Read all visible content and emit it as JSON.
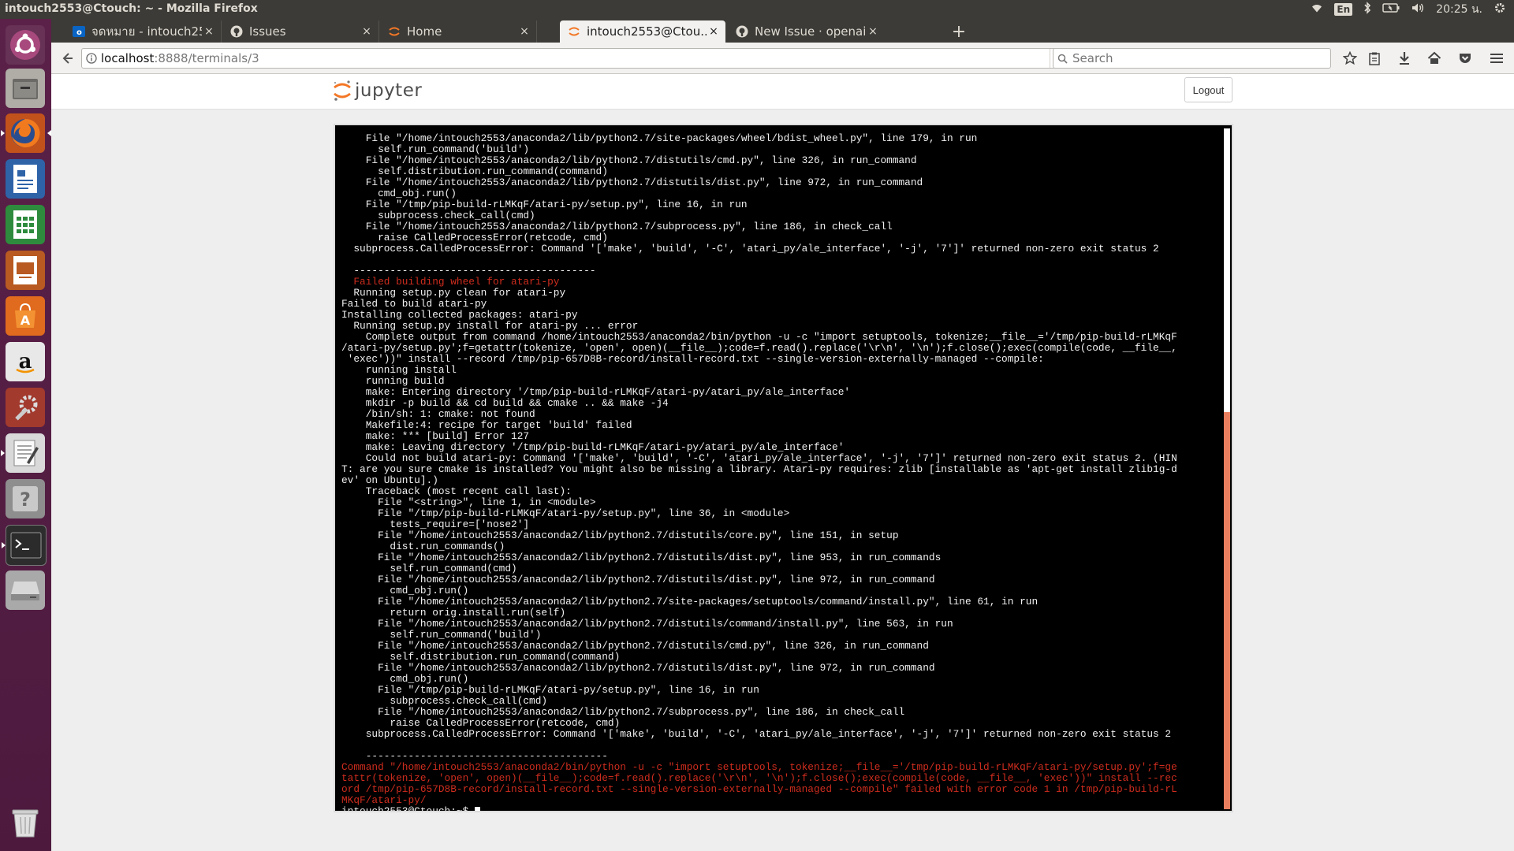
{
  "window": {
    "title": "intouch2553@Ctouch: ~ - Mozilla Firefox",
    "lang": "En",
    "clock": "20:25 น."
  },
  "tabs": [
    {
      "label": "จดหมาย - intouch25...",
      "icon": "outlook-icon",
      "active": false
    },
    {
      "label": "Issues",
      "icon": "github-icon",
      "active": false
    },
    {
      "label": "Home",
      "icon": "jupyter-icon",
      "active": false
    },
    {
      "label": "intouch2553@Ctou...",
      "icon": "jupyter-icon",
      "active": true
    },
    {
      "label": "New Issue · openai/...",
      "icon": "github-icon",
      "active": false
    }
  ],
  "close_glyph": "×",
  "newtab_glyph": "+",
  "nav": {
    "url_host": "localhost",
    "url_path": ":8888/terminals/3",
    "search_placeholder": "Search"
  },
  "jupyter": {
    "logo_text": "jupyter",
    "logout_label": "Logout"
  },
  "colors": {
    "terminal_bg": "#000000",
    "terminal_fg": "#f0f0f0",
    "terminal_error": "#cd2c1e",
    "scroll_thumb": "#e87e5e",
    "launcher": "#5b2148"
  },
  "terminal": {
    "prompt": "intouch2553@Ctouch:~$ ",
    "lines": [
      {
        "text": "    File \"/home/intouch2553/anaconda2/lib/python2.7/site-packages/wheel/bdist_wheel.py\", line 179, in run"
      },
      {
        "text": "      self.run_command('build')"
      },
      {
        "text": "    File \"/home/intouch2553/anaconda2/lib/python2.7/distutils/cmd.py\", line 326, in run_command"
      },
      {
        "text": "      self.distribution.run_command(command)"
      },
      {
        "text": "    File \"/home/intouch2553/anaconda2/lib/python2.7/distutils/dist.py\", line 972, in run_command"
      },
      {
        "text": "      cmd_obj.run()"
      },
      {
        "text": "    File \"/tmp/pip-build-rLMKqF/atari-py/setup.py\", line 16, in run"
      },
      {
        "text": "      subprocess.check_call(cmd)"
      },
      {
        "text": "    File \"/home/intouch2553/anaconda2/lib/python2.7/subprocess.py\", line 186, in check_call"
      },
      {
        "text": "      raise CalledProcessError(retcode, cmd)"
      },
      {
        "text": "  subprocess.CalledProcessError: Command '['make', 'build', '-C', 'atari_py/ale_interface', '-j', '7']' returned non-zero exit status 2"
      },
      {
        "text": ""
      },
      {
        "text": "  ----------------------------------------"
      },
      {
        "text": "  Failed building wheel for atari-py",
        "red": true
      },
      {
        "text": "  Running setup.py clean for atari-py"
      },
      {
        "text": "Failed to build atari-py"
      },
      {
        "text": "Installing collected packages: atari-py"
      },
      {
        "text": "  Running setup.py install for atari-py ... error"
      },
      {
        "text": "    Complete output from command /home/intouch2553/anaconda2/bin/python -u -c \"import setuptools, tokenize;__file__='/tmp/pip-build-rLMKqF"
      },
      {
        "text": "/atari-py/setup.py';f=getattr(tokenize, 'open', open)(__file__);code=f.read().replace('\\r\\n', '\\n');f.close();exec(compile(code, __file__,"
      },
      {
        "text": " 'exec'))\" install --record /tmp/pip-657D8B-record/install-record.txt --single-version-externally-managed --compile:"
      },
      {
        "text": "    running install"
      },
      {
        "text": "    running build"
      },
      {
        "text": "    make: Entering directory '/tmp/pip-build-rLMKqF/atari-py/atari_py/ale_interface'"
      },
      {
        "text": "    mkdir -p build && cd build && cmake .. && make -j4"
      },
      {
        "text": "    /bin/sh: 1: cmake: not found"
      },
      {
        "text": "    Makefile:4: recipe for target 'build' failed"
      },
      {
        "text": "    make: *** [build] Error 127"
      },
      {
        "text": "    make: Leaving directory '/tmp/pip-build-rLMKqF/atari-py/atari_py/ale_interface'"
      },
      {
        "text": "    Could not build atari-py: Command '['make', 'build', '-C', 'atari_py/ale_interface', '-j', '7']' returned non-zero exit status 2. (HIN"
      },
      {
        "text": "T: are you sure cmake is installed? You might also be missing a library. Atari-py requires: zlib [installable as 'apt-get install zlib1g-d"
      },
      {
        "text": "ev' on Ubuntu].)"
      },
      {
        "text": "    Traceback (most recent call last):"
      },
      {
        "text": "      File \"<string>\", line 1, in <module>"
      },
      {
        "text": "      File \"/tmp/pip-build-rLMKqF/atari-py/setup.py\", line 36, in <module>"
      },
      {
        "text": "        tests_require=['nose2']"
      },
      {
        "text": "      File \"/home/intouch2553/anaconda2/lib/python2.7/distutils/core.py\", line 151, in setup"
      },
      {
        "text": "        dist.run_commands()"
      },
      {
        "text": "      File \"/home/intouch2553/anaconda2/lib/python2.7/distutils/dist.py\", line 953, in run_commands"
      },
      {
        "text": "        self.run_command(cmd)"
      },
      {
        "text": "      File \"/home/intouch2553/anaconda2/lib/python2.7/distutils/dist.py\", line 972, in run_command"
      },
      {
        "text": "        cmd_obj.run()"
      },
      {
        "text": "      File \"/home/intouch2553/anaconda2/lib/python2.7/site-packages/setuptools/command/install.py\", line 61, in run"
      },
      {
        "text": "        return orig.install.run(self)"
      },
      {
        "text": "      File \"/home/intouch2553/anaconda2/lib/python2.7/distutils/command/install.py\", line 563, in run"
      },
      {
        "text": "        self.run_command('build')"
      },
      {
        "text": "      File \"/home/intouch2553/anaconda2/lib/python2.7/distutils/cmd.py\", line 326, in run_command"
      },
      {
        "text": "        self.distribution.run_command(command)"
      },
      {
        "text": "      File \"/home/intouch2553/anaconda2/lib/python2.7/distutils/dist.py\", line 972, in run_command"
      },
      {
        "text": "        cmd_obj.run()"
      },
      {
        "text": "      File \"/tmp/pip-build-rLMKqF/atari-py/setup.py\", line 16, in run"
      },
      {
        "text": "        subprocess.check_call(cmd)"
      },
      {
        "text": "      File \"/home/intouch2553/anaconda2/lib/python2.7/subprocess.py\", line 186, in check_call"
      },
      {
        "text": "        raise CalledProcessError(retcode, cmd)"
      },
      {
        "text": "    subprocess.CalledProcessError: Command '['make', 'build', '-C', 'atari_py/ale_interface', '-j', '7']' returned non-zero exit status 2"
      },
      {
        "text": ""
      },
      {
        "text": "    ----------------------------------------"
      },
      {
        "text": "Command \"/home/intouch2553/anaconda2/bin/python -u -c \"import setuptools, tokenize;__file__='/tmp/pip-build-rLMKqF/atari-py/setup.py';f=ge",
        "red": true
      },
      {
        "text": "tattr(tokenize, 'open', open)(__file__);code=f.read().replace('\\r\\n', '\\n');f.close();exec(compile(code, __file__, 'exec'))\" install --rec",
        "red": true
      },
      {
        "text": "ord /tmp/pip-657D8B-record/install-record.txt --single-version-externally-managed --compile\" failed with error code 1 in /tmp/pip-build-rL",
        "red": true
      },
      {
        "text": "MKqF/atari-py/",
        "red": true
      }
    ]
  }
}
